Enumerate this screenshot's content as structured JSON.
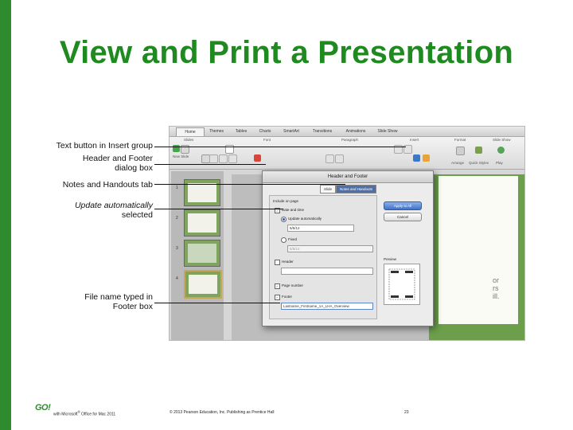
{
  "slide": {
    "title": "View and Print a Presentation",
    "callouts": {
      "text_button": "Text button in Insert group",
      "header_footer_line1": "Header and Footer",
      "header_footer_line2": "dialog box",
      "notes_tab": "Notes and Handouts tab",
      "update_line1": "Update automatically",
      "update_line2": "selected",
      "file_name_line1": "File name typed in",
      "file_name_line2": "Footer box"
    },
    "footer": {
      "logo": "GO!",
      "series_prefix": "with Microsoft",
      "series_suffix": "Office for Mac 2011",
      "copyright": "© 2013 Pearson Education, Inc. Publishing as Prentice Hall",
      "page_number": "23"
    },
    "colors": {
      "accent_green": "#2e8b2e",
      "title_green": "#1f8a1f"
    }
  },
  "screenshot": {
    "tabs": [
      "Home",
      "Themes",
      "Tables",
      "Charts",
      "SmartArt",
      "Transitions",
      "Animations",
      "Slide Show"
    ],
    "active_tab": "Home",
    "ribbon_groups": [
      "Slides",
      "Font",
      "Paragraph",
      "Insert",
      "Format",
      "Slide Show"
    ],
    "new_slide": "New Slide",
    "ribbon_buttons": [
      "Arrange",
      "Quick Styles",
      "Play"
    ],
    "thumb_numbers": [
      "1",
      "2",
      "3",
      "4"
    ],
    "partial_text": [
      "or",
      "rs",
      "ill."
    ],
    "dialog": {
      "title": "Header and Footer",
      "tabs": [
        "Slide",
        "Notes and Handouts"
      ],
      "active_tab": "Notes and Handouts",
      "section": "Include on page",
      "date_and_time": "Date and time",
      "update_automatically": "Update automatically",
      "auto_date_value": "6/5/12",
      "fixed": "Fixed",
      "fixed_value": "6/5/12",
      "header": "Header",
      "page_number": "Page number",
      "footer": "Footer",
      "footer_value": "Lastname_Firstname_1A_LHA_Overview",
      "apply_all": "Apply to All",
      "cancel": "Cancel",
      "preview": "Preview"
    }
  }
}
